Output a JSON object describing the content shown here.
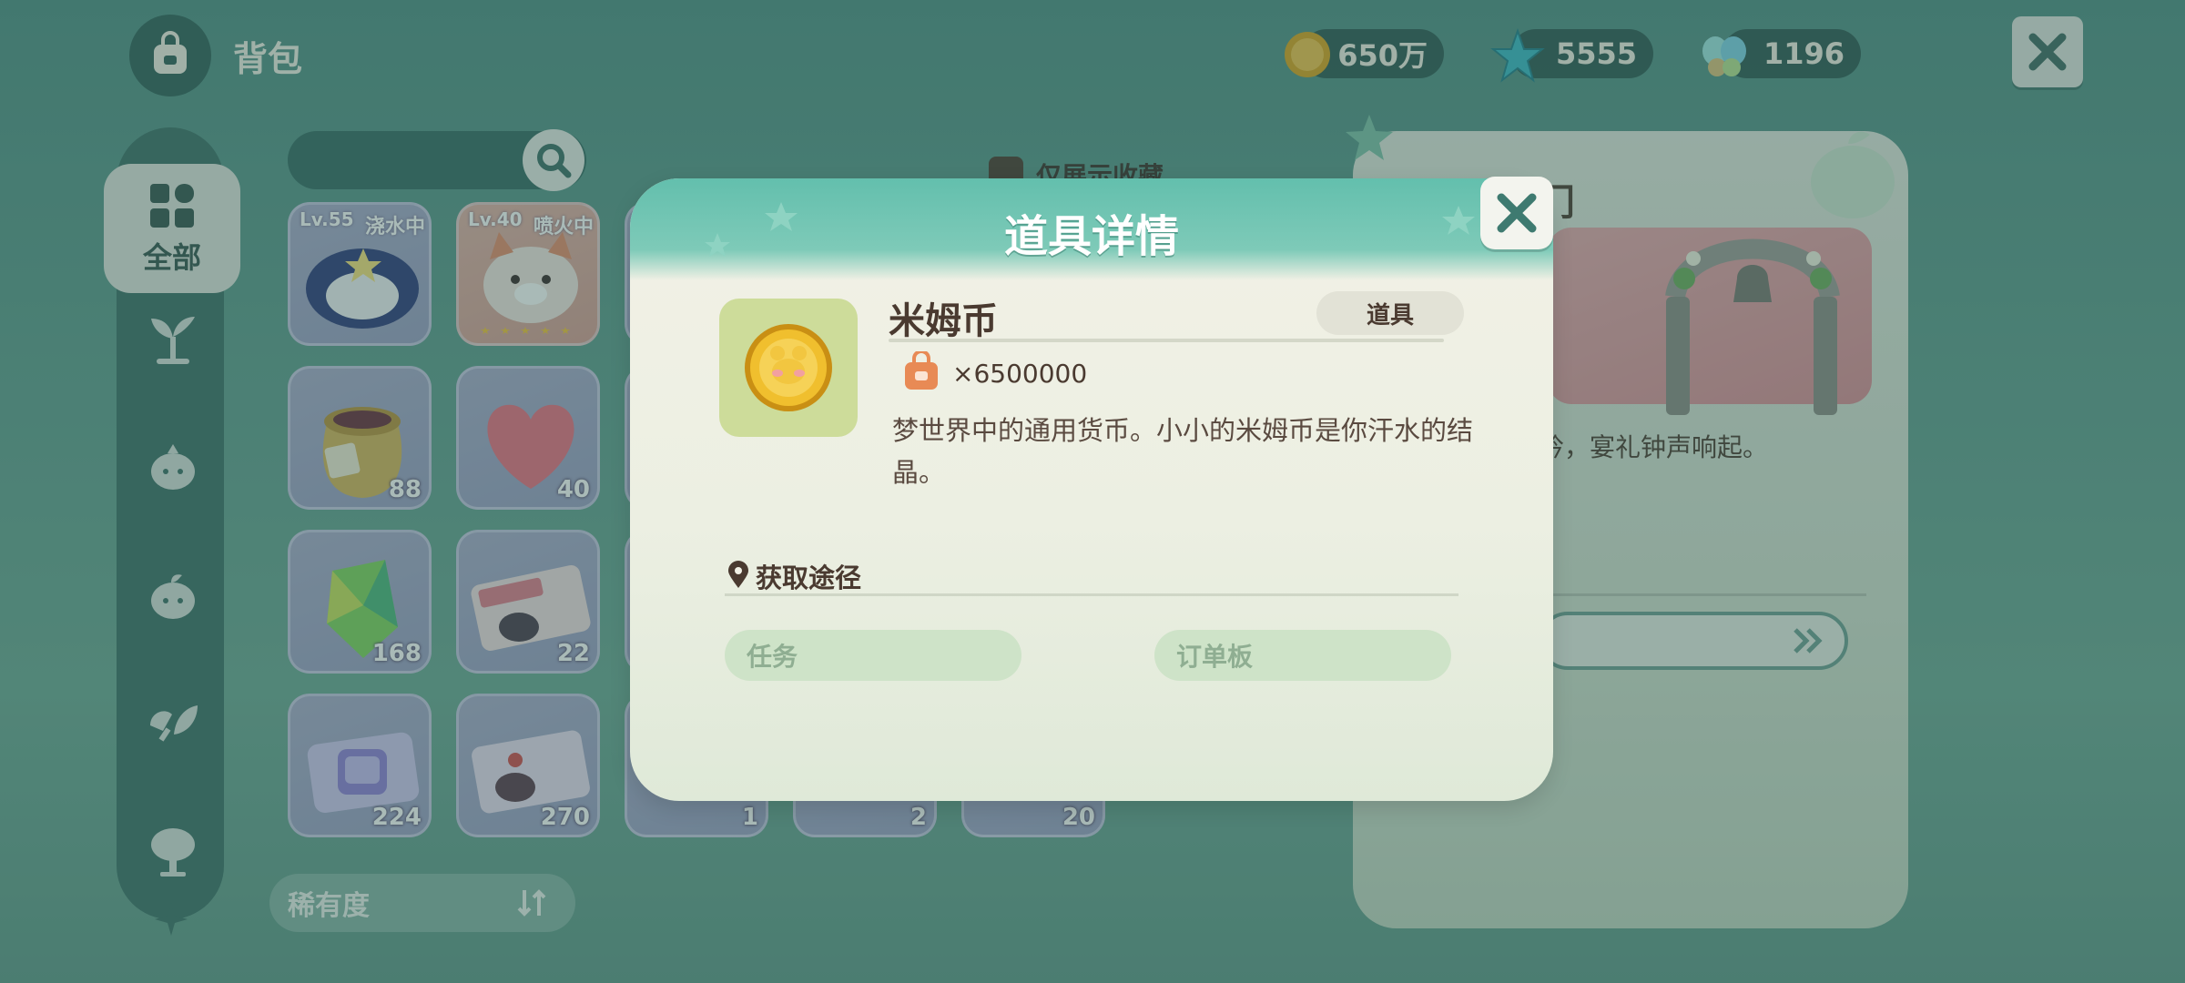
{
  "header": {
    "title": "背包"
  },
  "currencies": [
    {
      "name": "coin",
      "value": "650万"
    },
    {
      "name": "star",
      "value": "5555"
    },
    {
      "name": "gem",
      "value": "1196"
    }
  ],
  "sidebar": {
    "active_label": "全部"
  },
  "filters": {
    "favorites_label": "仅展示收藏",
    "sort_label": "稀有度"
  },
  "grid": {
    "items": [
      {
        "level": "Lv.55",
        "tag": "浇水中",
        "count": ""
      },
      {
        "level": "Lv.40",
        "tag": "喷火中",
        "count": ""
      },
      {
        "count": "88"
      },
      {
        "count": "40"
      },
      {
        "count": "168"
      },
      {
        "count": "22"
      },
      {
        "count": "224"
      },
      {
        "count": "270"
      },
      {
        "count": "1"
      },
      {
        "count": "2"
      },
      {
        "count": "20"
      }
    ]
  },
  "right_panel": {
    "title_fragment": "门",
    "desc_fragment": "吟，宴礼钟声响起。"
  },
  "modal": {
    "title": "道具详情",
    "item_name": "米姆币",
    "item_type": "道具",
    "owned_count": "×6500000",
    "description": "梦世界中的通用货币。小小的米姆币是你汗水的结晶。",
    "source_title": "获取途径",
    "sources": [
      "任务",
      "订单板"
    ]
  },
  "colors": {
    "modal_header": "#63bfad",
    "coin_gold": "#e3b12a",
    "thumb_bg": "#cddc9a"
  }
}
